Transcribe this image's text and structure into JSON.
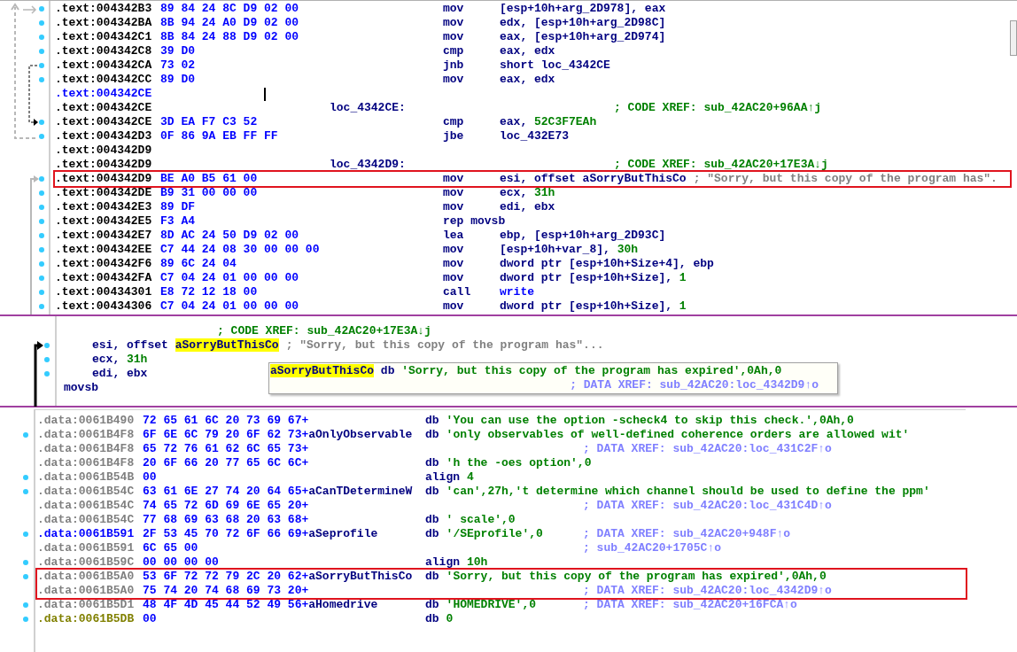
{
  "code_view": {
    "rows": [
      {
        "address": ".text:004342B3",
        "kind": "plain",
        "dot": true,
        "cursor": false,
        "boxed": false,
        "bytes": "89 84 24 8C D9 02 00",
        "mnemonic": "mov",
        "operands": [
          {
            "text": "[esp+10h+arg_2D978], eax",
            "kind": "plain"
          }
        ]
      },
      {
        "address": ".text:004342BA",
        "kind": "plain",
        "dot": true,
        "cursor": false,
        "boxed": false,
        "bytes": "8B 94 24 A0 D9 02 00",
        "mnemonic": "mov",
        "operands": [
          {
            "text": "edx, [esp+10h+arg_2D98C]",
            "kind": "plain"
          }
        ]
      },
      {
        "address": ".text:004342C1",
        "kind": "plain",
        "dot": true,
        "cursor": false,
        "boxed": false,
        "bytes": "8B 84 24 88 D9 02 00",
        "mnemonic": "mov",
        "operands": [
          {
            "text": "eax, [esp+10h+arg_2D974]",
            "kind": "plain"
          }
        ]
      },
      {
        "address": ".text:004342C8",
        "kind": "plain",
        "dot": true,
        "cursor": false,
        "boxed": false,
        "bytes": "39 D0",
        "mnemonic": "cmp",
        "operands": [
          {
            "text": "eax, edx",
            "kind": "plain"
          }
        ]
      },
      {
        "address": ".text:004342CA",
        "kind": "plain",
        "dot": true,
        "cursor": false,
        "boxed": false,
        "bytes": "73 02",
        "mnemonic": "jnb",
        "operands": [
          {
            "text": "short loc_4342CE",
            "kind": "plain"
          }
        ]
      },
      {
        "address": ".text:004342CC",
        "kind": "plain",
        "dot": true,
        "cursor": false,
        "boxed": false,
        "bytes": "89 D0",
        "mnemonic": "mov",
        "operands": [
          {
            "text": "eax, edx",
            "kind": "plain"
          }
        ]
      },
      {
        "address": ".text:004342CE",
        "kind": "named",
        "dot": false,
        "cursor": true,
        "boxed": false
      },
      {
        "address": ".text:004342CE",
        "kind": "plain",
        "dot": false,
        "cursor": false,
        "boxed": false,
        "label": "loc_4342CE:",
        "comment": {
          "text": "; CODE XREF: sub_42AC20+96AA↑j",
          "kind": "code_xref"
        }
      },
      {
        "address": ".text:004342CE",
        "kind": "plain",
        "dot": true,
        "cursor": false,
        "boxed": false,
        "bytes": "3D EA F7 C3 52",
        "mnemonic": "cmp",
        "operands": [
          {
            "text": "eax, ",
            "kind": "plain"
          },
          {
            "text": "52C3F7EAh",
            "kind": "num"
          }
        ]
      },
      {
        "address": ".text:004342D3",
        "kind": "plain",
        "dot": true,
        "cursor": false,
        "boxed": false,
        "bytes": "0F 86 9A EB FF FF",
        "mnemonic": "jbe",
        "operands": [
          {
            "text": "loc_432E73",
            "kind": "plain"
          }
        ]
      },
      {
        "address": ".text:004342D9",
        "kind": "plain",
        "dot": false,
        "cursor": false,
        "boxed": false
      },
      {
        "address": ".text:004342D9",
        "kind": "plain",
        "dot": false,
        "cursor": false,
        "boxed": false,
        "label": "loc_4342D9:",
        "comment": {
          "text": "; CODE XREF: sub_42AC20+17E3A↓j",
          "kind": "code_xref"
        }
      },
      {
        "address": ".text:004342D9",
        "kind": "plain",
        "dot": true,
        "cursor": false,
        "boxed": true,
        "bytes": "BE A0 B5 61 00",
        "mnemonic": "mov",
        "operands": [
          {
            "text": "esi, offset aSorryButThisCo",
            "kind": "plain"
          }
        ],
        "comment": {
          "text": "; \"Sorry, but this copy of the program has\".",
          "kind": "string"
        }
      },
      {
        "address": ".text:004342DE",
        "kind": "plain",
        "dot": true,
        "cursor": false,
        "boxed": false,
        "bytes": "B9 31 00 00 00",
        "mnemonic": "mov",
        "operands": [
          {
            "text": "ecx, ",
            "kind": "plain"
          },
          {
            "text": "31h",
            "kind": "num"
          }
        ]
      },
      {
        "address": ".text:004342E3",
        "kind": "plain",
        "dot": true,
        "cursor": false,
        "boxed": false,
        "bytes": "89 DF",
        "mnemonic": "mov",
        "operands": [
          {
            "text": "edi, ebx",
            "kind": "plain"
          }
        ]
      },
      {
        "address": ".text:004342E5",
        "kind": "plain",
        "dot": true,
        "cursor": false,
        "boxed": false,
        "bytes": "F3 A4",
        "mnemonic": "rep movsb"
      },
      {
        "address": ".text:004342E7",
        "kind": "plain",
        "dot": true,
        "cursor": false,
        "boxed": false,
        "bytes": "8D AC 24 50 D9 02 00",
        "mnemonic": "lea",
        "operands": [
          {
            "text": "ebp, [esp+10h+arg_2D93C]",
            "kind": "plain"
          }
        ]
      },
      {
        "address": ".text:004342EE",
        "kind": "plain",
        "dot": true,
        "cursor": false,
        "boxed": false,
        "bytes": "C7 44 24 08 30 00 00 00",
        "mnemonic": "mov",
        "operands": [
          {
            "text": "[esp+10h+var_8], ",
            "kind": "plain"
          },
          {
            "text": "30h",
            "kind": "num"
          }
        ]
      },
      {
        "address": ".text:004342F6",
        "kind": "plain",
        "dot": true,
        "cursor": false,
        "boxed": false,
        "bytes": "89 6C 24 04",
        "mnemonic": "mov",
        "operands": [
          {
            "text": "dword ptr [esp+10h+Size+4], ebp",
            "kind": "plain"
          }
        ]
      },
      {
        "address": ".text:004342FA",
        "kind": "plain",
        "dot": true,
        "cursor": false,
        "boxed": false,
        "bytes": "C7 04 24 01 00 00 00",
        "mnemonic": "mov",
        "operands": [
          {
            "text": "dword ptr [esp+10h+Size], ",
            "kind": "plain"
          },
          {
            "text": "1",
            "kind": "num"
          }
        ]
      },
      {
        "address": ".text:00434301",
        "kind": "plain",
        "dot": true,
        "cursor": false,
        "boxed": false,
        "bytes": "E8 72 12 18 00",
        "mnemonic": "call",
        "operands": [
          {
            "text": "write",
            "kind": "func"
          }
        ]
      },
      {
        "address": ".text:00434306",
        "kind": "plain",
        "dot": true,
        "cursor": false,
        "boxed": false,
        "bytes": "C7 04 24 01 00 00 00",
        "mnemonic": "mov",
        "operands": [
          {
            "text": "dword ptr [esp+10h+Size], ",
            "kind": "plain"
          },
          {
            "text": "1",
            "kind": "num"
          }
        ]
      }
    ]
  },
  "hint_view": {
    "lines": [
      {
        "kind": "xref",
        "dot": false,
        "comment": {
          "text": "; CODE XREF: sub_42AC20+17E3A↓j",
          "kind": "code_xref"
        }
      },
      {
        "kind": "code",
        "dot": true,
        "operands": [
          {
            "text": "esi, offset ",
            "kind": "plain"
          },
          {
            "text": "aSorryButThisCo",
            "kind": "highlight"
          }
        ],
        "comment": {
          "text": "; \"Sorry, but this copy of the program has\"...",
          "kind": "string"
        }
      },
      {
        "kind": "code",
        "dot": true,
        "operands": [
          {
            "text": "ecx, ",
            "kind": "plain"
          },
          {
            "text": "31h",
            "kind": "num"
          }
        ]
      },
      {
        "kind": "code",
        "dot": true,
        "operands": [
          {
            "text": "edi, ebx",
            "kind": "plain"
          }
        ]
      },
      {
        "kind": "tail",
        "dot": false,
        "mnemonic": "movsb"
      }
    ],
    "tooltip": {
      "definition": [
        {
          "text": "aSorryButThisCo",
          "kind": "highlight"
        },
        {
          "text": " db ",
          "kind": "plain"
        },
        {
          "text": "'Sorry, but this copy of the program has expired',0Ah,0",
          "kind": "num"
        }
      ],
      "xref": "; DATA XREF: sub_42AC20:loc_4342D9↑o"
    }
  },
  "data_view": {
    "rows": [
      {
        "address": ".data:0061B490",
        "kind": "plain",
        "dot": false,
        "boxed": false,
        "bytes": "72 65 61 6C 20 73 69 67+",
        "mnemonic": "db",
        "operands": "'You can use the option -scheck4 to skip this check.',0Ah,0"
      },
      {
        "address": ".data:0061B4F8",
        "kind": "plain",
        "dot": true,
        "boxed": false,
        "bytes": "6F 6E 6C 79 20 6F 62 73+",
        "label": "aOnlyObservable",
        "mnemonic": "db",
        "operands": "'only observables of well-defined coherence orders are allowed wit'"
      },
      {
        "address": ".data:0061B4F8",
        "kind": "plain",
        "dot": false,
        "boxed": false,
        "bytes": "65 72 76 61 62 6C 65 73+",
        "comment": "; DATA XREF: sub_42AC20:loc_431C2F↑o"
      },
      {
        "address": ".data:0061B4F8",
        "kind": "plain",
        "dot": false,
        "boxed": false,
        "bytes": "20 6F 66 20 77 65 6C 6C+",
        "mnemonic": "db",
        "operands": "'h the -oes option',0"
      },
      {
        "address": ".data:0061B54B",
        "kind": "plain",
        "dot": true,
        "boxed": false,
        "bytes": "00",
        "mnemonic": "align",
        "operands": "4"
      },
      {
        "address": ".data:0061B54C",
        "kind": "plain",
        "dot": true,
        "boxed": false,
        "bytes": "63 61 6E 27 74 20 64 65+",
        "label": "aCanTDetermineW",
        "mnemonic": "db",
        "operands": "'can',27h,'t determine which channel should be used to define the ppm'"
      },
      {
        "address": ".data:0061B54C",
        "kind": "plain",
        "dot": false,
        "boxed": false,
        "bytes": "74 65 72 6D 69 6E 65 20+",
        "comment": "; DATA XREF: sub_42AC20:loc_431C4D↑o"
      },
      {
        "address": ".data:0061B54C",
        "kind": "plain",
        "dot": false,
        "boxed": false,
        "bytes": "77 68 69 63 68 20 63 68+",
        "mnemonic": "db",
        "operands": "' scale',0"
      },
      {
        "address": ".data:0061B591",
        "kind": "named",
        "dot": true,
        "boxed": false,
        "bytes": "2F 53 45 70 72 6F 66 69+",
        "label": "aSeprofile",
        "mnemonic": "db",
        "operands": "'/SEprofile',0",
        "comment": "; DATA XREF: sub_42AC20+948F↑o"
      },
      {
        "address": ".data:0061B591",
        "kind": "plain",
        "dot": false,
        "boxed": false,
        "bytes": "6C 65 00",
        "comment": "; sub_42AC20+1705C↑o"
      },
      {
        "address": ".data:0061B59C",
        "kind": "plain",
        "dot": true,
        "boxed": false,
        "bytes": "00 00 00 00",
        "mnemonic": "align",
        "operands": "10h"
      },
      {
        "address": ".data:0061B5A0",
        "kind": "plain",
        "dot": true,
        "boxed": true,
        "bytes": "53 6F 72 72 79 2C 20 62+",
        "label": "aSorryButThisCo",
        "mnemonic": "db",
        "operands": "'Sorry, but this copy of the program has expired',0Ah,0"
      },
      {
        "address": ".data:0061B5A0",
        "kind": "plain",
        "dot": false,
        "boxed": true,
        "bytes": "75 74 20 74 68 69 73 20+",
        "comment": "; DATA XREF: sub_42AC20:loc_4342D9↑o"
      },
      {
        "address": ".data:0061B5D1",
        "kind": "plain",
        "dot": true,
        "boxed": false,
        "bytes": "48 4F 4D 45 44 52 49 56+",
        "label": "aHomedrive",
        "mnemonic": "db",
        "operands": "'HOMEDRIVE',0",
        "comment": "; DATA XREF: sub_42AC20+16FCA↑o"
      },
      {
        "address": ".data:0061B5DB",
        "kind": "unexplored",
        "dot": true,
        "boxed": false,
        "bytes": "00",
        "mnemonic": "db",
        "operands": "0"
      }
    ]
  }
}
